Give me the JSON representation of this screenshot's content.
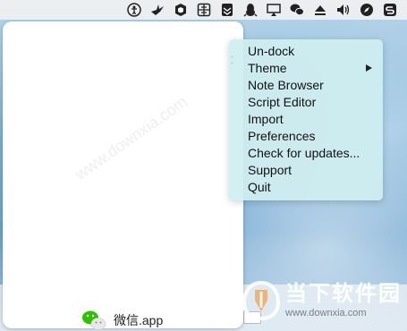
{
  "menubar": {
    "icons": [
      "accessibility-icon",
      "bird-icon",
      "shield-icon",
      "grid-icon",
      "stack-icon",
      "qq-penguin-icon",
      "airplay-icon",
      "wechat-icon",
      "eject-icon",
      "volume-icon",
      "compass-icon",
      "s-app-icon"
    ]
  },
  "panel": {
    "app_name": "微信.app",
    "watermark": "www.downxia.com"
  },
  "context_menu": {
    "items": [
      {
        "label": "Un-dock"
      },
      {
        "label": "Theme",
        "has_submenu": true
      },
      {
        "label": "Note Browser"
      },
      {
        "label": "Script Editor"
      },
      {
        "label": "Import"
      },
      {
        "label": "Preferences"
      },
      {
        "label": "Check for updates..."
      },
      {
        "label": "Support"
      },
      {
        "label": "Quit"
      }
    ]
  },
  "site_logo": {
    "text_cn": "当下软件园",
    "url": "www.downxia.com"
  },
  "colors": {
    "menu_bg": "#d0eef0",
    "wechat_green": "#2dc100",
    "logo_orange": "#f08a1c"
  }
}
